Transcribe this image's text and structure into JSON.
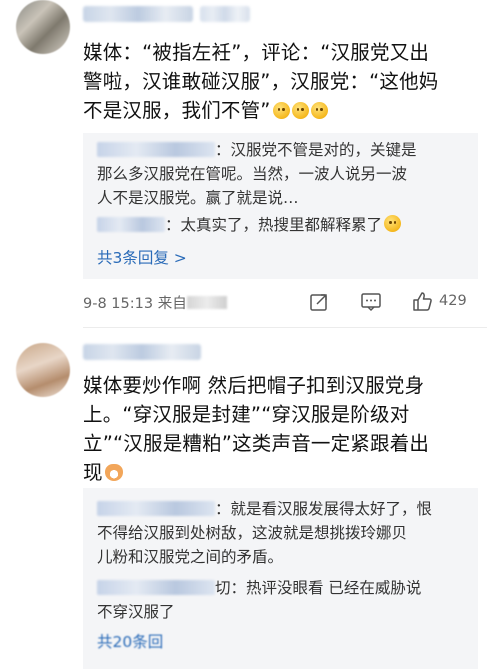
{
  "comments": [
    {
      "text_lines": [
        "媒体：“被指左衽”，评论：“汉服党又出",
        "警啦，汉谁敢碰汉服”，汉服党：“这他妈",
        "不是汉服，我们不管”"
      ],
      "replies": [
        {
          "lines": [
            "：汉服党不管是对的，关键是",
            "那么多汉服党在管呢。当然，一波人说另一波",
            "人不是汉服党。赢了就是说…"
          ]
        },
        {
          "lines": [
            "：太真实了，热搜里都解释累了"
          ]
        }
      ],
      "more_replies": "共3条回复 >",
      "time": "9-8 15:13",
      "source_prefix": "来自",
      "like_count": "429"
    },
    {
      "text_lines": [
        "媒体要炒作啊 然后把帽子扣到汉服党身",
        "上。“穿汉服是封建”“穿汉服是阶级对",
        "立”“汉服是糟粕”这类声音一定紧跟着出",
        "现"
      ],
      "replies": [
        {
          "lines": [
            "：就是看汉服发展得太好了，恨",
            "不得给汉服到处树敌，这波就是想挑拨玲娜贝",
            "儿粉和汉服党之间的矛盾。"
          ]
        },
        {
          "lines": [
            "切：热评没眼看   已经在威胁说",
            "不穿汉服了"
          ]
        }
      ],
      "more_replies": "共20条回"
    }
  ],
  "icons": {
    "share": "share-icon",
    "comment": "comment-icon",
    "like": "thumbs-up-icon"
  },
  "colors": {
    "link": "#2a6bb8",
    "reply_bg": "#f4f5f7"
  }
}
